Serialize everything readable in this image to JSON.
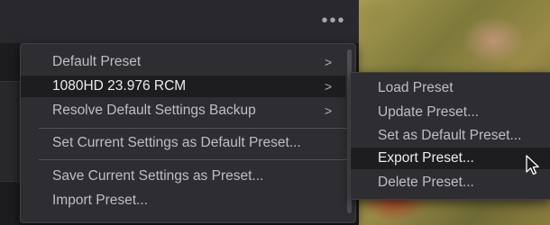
{
  "toolbar": {
    "more_options": "•••"
  },
  "menu": {
    "items": [
      {
        "label": "Default Preset",
        "chevron": ">"
      },
      {
        "label": "1080HD 23.976 RCM",
        "chevron": ">"
      },
      {
        "label": "Resolve Default Settings Backup",
        "chevron": ">"
      },
      {
        "label": "Set Current Settings as Default Preset..."
      },
      {
        "label": "Save Current Settings as Preset..."
      },
      {
        "label": "Import Preset..."
      }
    ]
  },
  "submenu": {
    "items": [
      {
        "label": "Load Preset"
      },
      {
        "label": "Update Preset..."
      },
      {
        "label": "Set as Default Preset..."
      },
      {
        "label": "Export Preset..."
      },
      {
        "label": "Delete Preset..."
      }
    ]
  },
  "icons": {
    "cursor": "mouse-pointer-icon"
  }
}
